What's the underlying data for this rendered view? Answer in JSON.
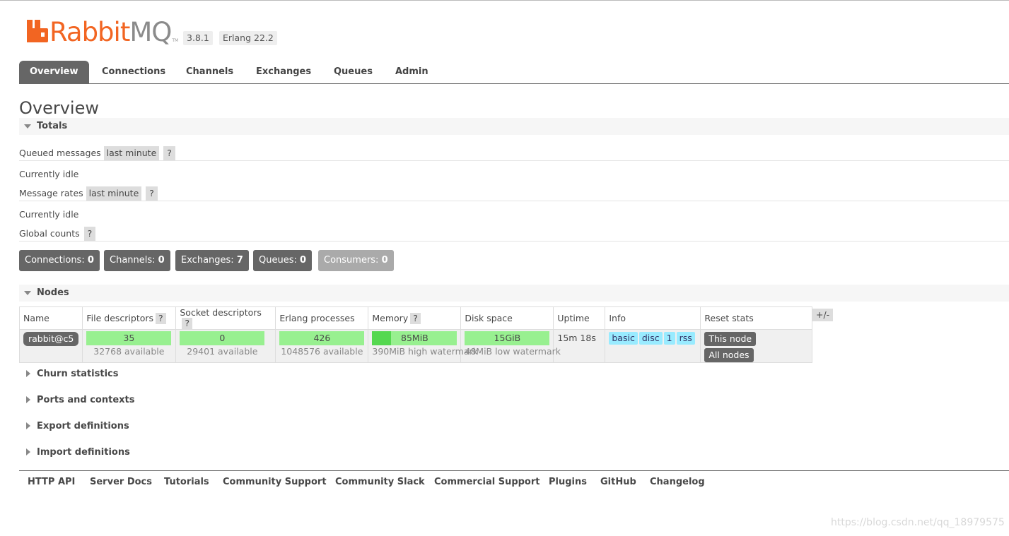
{
  "header": {
    "logo_text_a": "Rabbit",
    "logo_text_b": "MQ",
    "logo_tm": "TM",
    "version": "3.8.1",
    "erlang": "Erlang 22.2"
  },
  "tabs": [
    "Overview",
    "Connections",
    "Channels",
    "Exchanges",
    "Queues",
    "Admin"
  ],
  "page_title": "Overview",
  "totals": {
    "heading": "Totals",
    "queued_label": "Queued messages",
    "queued_range": "last minute",
    "help": "?",
    "queued_status": "Currently idle",
    "rates_label": "Message rates",
    "rates_range": "last minute",
    "rates_status": "Currently idle",
    "global_label": "Global counts"
  },
  "counts": [
    {
      "label": "Connections:",
      "value": "0"
    },
    {
      "label": "Channels:",
      "value": "0"
    },
    {
      "label": "Exchanges:",
      "value": "7"
    },
    {
      "label": "Queues:",
      "value": "0"
    },
    {
      "label": "Consumers:",
      "value": "0"
    }
  ],
  "nodes": {
    "heading": "Nodes",
    "columns": [
      "Name",
      "File descriptors",
      "Socket descriptors",
      "Erlang processes",
      "Memory",
      "Disk space",
      "Uptime",
      "Info",
      "Reset stats"
    ],
    "help": "?",
    "plus_minus": "+/-",
    "row": {
      "name": "rabbit@c5",
      "file_desc": "35",
      "file_desc_sub": "32768 available",
      "socket_desc": "0",
      "socket_desc_sub": "29401 available",
      "erlang_proc": "426",
      "erlang_proc_sub": "1048576 available",
      "memory": "85MiB",
      "memory_sub": "390MiB high watermark",
      "memory_fraction": 0.22,
      "disk": "15GiB",
      "disk_sub": "48MiB low watermark",
      "uptime": "15m 18s",
      "info": [
        "basic",
        "disc",
        "1",
        "rss"
      ],
      "reset_this": "This node",
      "reset_all": "All nodes"
    }
  },
  "collapsed_sections": [
    "Churn statistics",
    "Ports and contexts",
    "Export definitions",
    "Import definitions"
  ],
  "footer": [
    "HTTP API",
    "Server Docs",
    "Tutorials",
    "Community Support",
    "Community Slack",
    "Commercial Support",
    "Plugins",
    "GitHub",
    "Changelog"
  ],
  "watermark": "https://blog.csdn.net/qq_18979575",
  "colors": {
    "brand": "#f26522",
    "tab_active": "#666666",
    "bar_fill": "#98f090",
    "info_badge": "#99ebff"
  }
}
